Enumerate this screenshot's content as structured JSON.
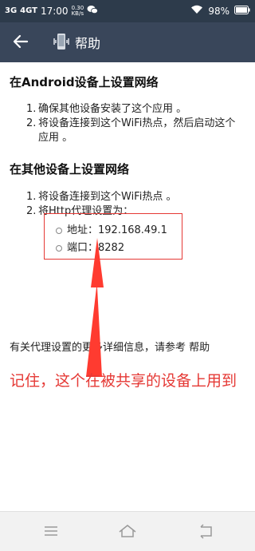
{
  "status_bar": {
    "carrier_left": "3G",
    "carrier_right": "4GT",
    "time": "17:00",
    "speed_value": "0.30",
    "speed_unit": "KB/s",
    "battery": "98%",
    "icons": [
      "signal-icon",
      "wechat-icon",
      "wifi-icon",
      "battery-icon"
    ]
  },
  "app_bar": {
    "title": "帮助",
    "back_icon": "arrow-left-icon",
    "app_icon": "phone-vibrate-icon"
  },
  "sections": [
    {
      "heading": "在Android设备上设置网络",
      "items": [
        {
          "num": "1.",
          "text": "确保其他设备安装了这个应用 。"
        },
        {
          "num": "2.",
          "text": "将设备连接到这个WiFi热点，然后启动这个应用 。"
        }
      ]
    },
    {
      "heading": "在其他设备上设置网络",
      "items": [
        {
          "num": "1.",
          "text": "将设备连接到这个WiFi热点 。"
        },
        {
          "num": "2.",
          "text": "将Http代理设置为："
        }
      ],
      "proxy": [
        {
          "text": "地址：192.168.49.1"
        },
        {
          "text": "端口：8282"
        }
      ]
    }
  ],
  "more_info": "有关代理设置的更多详细信息，请参考 帮助",
  "annotation": {
    "note": "记住，这个在被共享的设备上用到",
    "color": "#e53935"
  },
  "nav_bar": {
    "buttons": [
      "menu-icon",
      "home-icon",
      "back-icon"
    ]
  }
}
